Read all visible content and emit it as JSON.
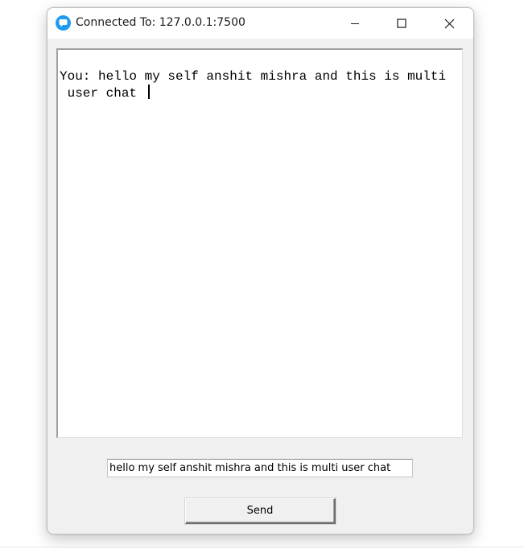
{
  "window": {
    "title": "Connected To: 127.0.0.1:7500",
    "app_icon": "chat-bubble-icon",
    "controls": {
      "minimize_icon": "minimize-icon",
      "maximize_icon": "maximize-icon",
      "close_icon": "close-icon"
    }
  },
  "chat": {
    "line1": "You: hello my self anshit mishra and this is multi",
    "line2": " user chat "
  },
  "composer": {
    "input_value": "hello my self anshit mishra and this is multi user chat",
    "send_label": "Send"
  },
  "colors": {
    "window_bg": "#f0f0f0",
    "titlebar_bg": "#ffffff",
    "app_icon_accent": "#1d9bf0"
  }
}
